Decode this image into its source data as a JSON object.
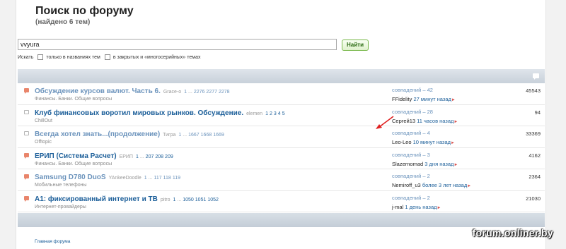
{
  "header": {
    "title": "Поиск по форуму",
    "subtitle": "(найдено 6 тем)"
  },
  "search": {
    "value": "vvyura",
    "button_label": "Найти",
    "search_label": "Искать",
    "option_titles": "только в названиях тем",
    "option_closed": "в закрытых и «многосерийных» темах"
  },
  "topics": [
    {
      "title": "Обсуждение курсов валют. Часть 6.",
      "author": "Grace-o",
      "pages": [
        "1",
        "...",
        "2276",
        "2277",
        "2278"
      ],
      "forum": "Финансы. Банки. Общие вопросы",
      "matches": "совпадений – 42",
      "last_user": "FFidelity",
      "last_ago": "27 минут назад",
      "views": "45543",
      "read": true,
      "icon": "hot"
    },
    {
      "title": "Клуб финансовых воротил мировых рынков. Обсуждение.",
      "author": "elemen",
      "pages": [
        "1",
        "2",
        "3",
        "4",
        "5"
      ],
      "forum": "ChillOut",
      "matches": "совпадений – 28",
      "last_user": "Сергей13",
      "last_ago": "11 часов назад",
      "views": "94",
      "read": false,
      "icon": "plain"
    },
    {
      "title": "Всегда хотел знать...(продолжение)",
      "author": "Тигра",
      "pages": [
        "1",
        "...",
        "1667",
        "1668",
        "1669"
      ],
      "forum": "Offtopic",
      "matches": "совпадений – 4",
      "last_user": "Leo-Leo",
      "last_ago": "10 минут назад",
      "views": "33369",
      "read": true,
      "icon": "plain"
    },
    {
      "title": "ЕРИП (Система Расчет)",
      "author": "ЕРИП",
      "pages": [
        "1",
        "...",
        "207",
        "208",
        "209"
      ],
      "forum": "Финансы. Банки. Общие вопросы",
      "matches": "совпадений – 3",
      "last_user": "Slazernomad",
      "last_ago": "3 дня назад",
      "views": "4162",
      "read": false,
      "icon": "hot"
    },
    {
      "title": "Samsung D780 DuoS",
      "author": "YAnkeeDoodle",
      "pages": [
        "1",
        "...",
        "117",
        "118",
        "119"
      ],
      "forum": "Мобильные телефоны",
      "matches": "совпадений – 2",
      "last_user": "Nemiroff_u3",
      "last_ago": "более 3 лет назад",
      "views": "2364",
      "read": true,
      "icon": "hot"
    },
    {
      "title": "А1: фиксированный интернет и ТВ",
      "author": "pitro",
      "pages": [
        "1",
        "...",
        "1050",
        "1051",
        "1052"
      ],
      "forum": "Интернет-провайдеры",
      "matches": "совпадений – 2",
      "last_user": "j-mal",
      "last_ago": "1 день назад",
      "views": "21030",
      "read": false,
      "icon": "hot"
    }
  ],
  "footer": {
    "home_link": "Главная форума",
    "watermark": "forum.onliner.by"
  },
  "colors": {
    "link": "#1b5e99",
    "visited": "#6b93bc",
    "hot_icon": "#e9856b",
    "button_border": "#7ab84d",
    "arrow": "#e02020"
  }
}
